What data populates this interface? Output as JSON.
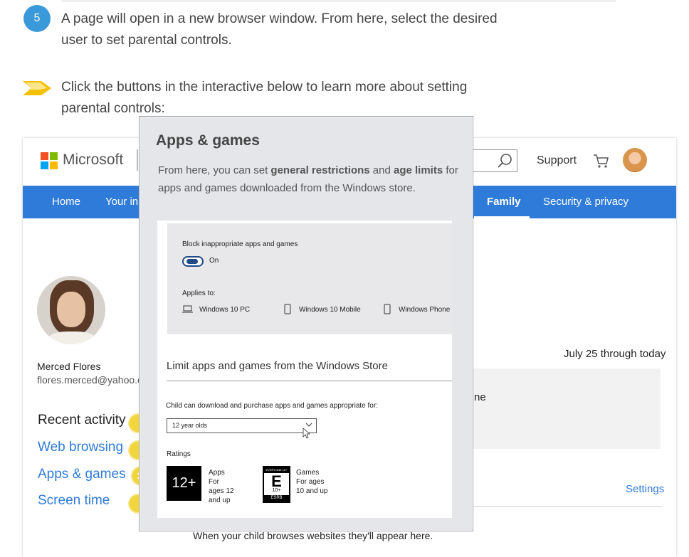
{
  "step": {
    "number": "5",
    "line1": "A page will open in a new browser window. From here, select the desired",
    "line2": "user to set parental controls."
  },
  "tip": {
    "line1": "Click the buttons in the interactive below to learn more about setting",
    "line2": "parental controls:"
  },
  "ms_page": {
    "brand": "Microsoft",
    "support": "Support",
    "nav": {
      "home": "Home",
      "your": "Your in",
      "family": "Family",
      "security": "Security & privacy"
    },
    "user": {
      "name": "Merced Flores",
      "email": "flores.merced@yahoo.c"
    },
    "sidebar": [
      "Recent activity",
      "Web browsing",
      "Apps & games",
      "Screen time"
    ],
    "date_range": "July 25 through today",
    "partial": "ne",
    "settings": "Settings",
    "footer": "When your child browses websites they'll appear here."
  },
  "popup": {
    "title": "Apps & games",
    "desc": {
      "p1": "From here, you can set ",
      "b1": "general restrictions",
      "p2": " and ",
      "b2": "age limits",
      "p3": " for apps and games downloaded from the Windows store."
    },
    "block": {
      "label": "Block inappropriate apps and games",
      "toggle": "On"
    },
    "applies": {
      "label": "Applies to:",
      "devices": [
        "Windows 10 PC",
        "Windows 10 Mobile",
        "Windows Phone"
      ]
    },
    "limit_heading": "Limit apps and games from the Windows Store",
    "child_label": "Child can download and purchase apps and games appropriate for:",
    "select_value": "12 year olds",
    "ratings_label": "Ratings",
    "rating_apps": {
      "badge": "12+",
      "l1": "Apps",
      "l2": "For",
      "l3": "ages 12",
      "l4": "and up"
    },
    "rating_games": {
      "badge_top": "EVERYONE 10+",
      "badge_letter": "E",
      "badge_sub": "10+",
      "badge_bottom": "ESRB",
      "l1": "Games",
      "l2": "For ages",
      "l3": "10 and up"
    }
  },
  "colors": {
    "accent": "#2f7bd9",
    "step": "#3a9ad9",
    "hotspot": "#f1d53d"
  }
}
